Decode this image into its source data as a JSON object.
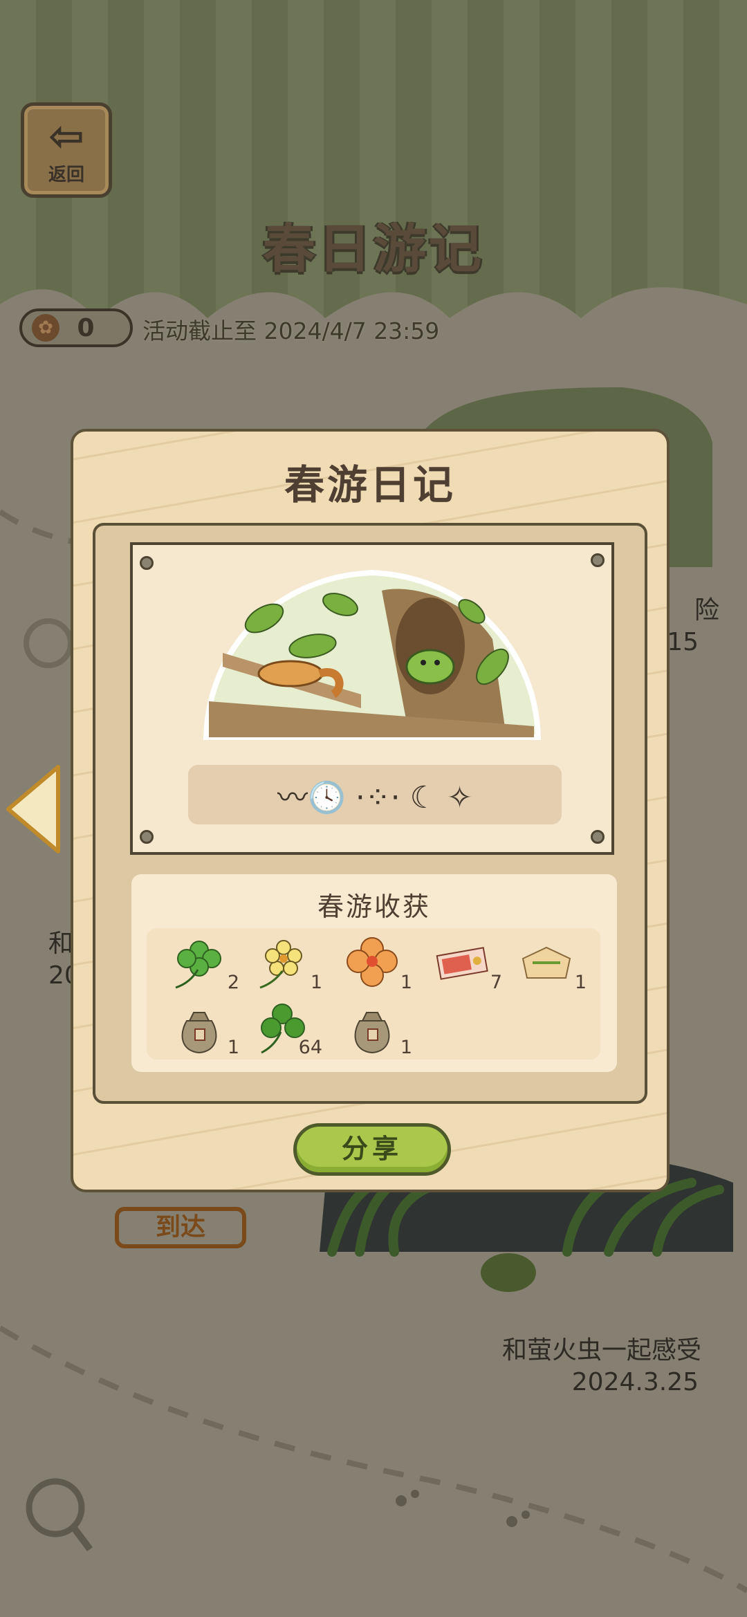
{
  "header": {
    "back_label": "返回",
    "title": "春日游记",
    "clover_count": "0",
    "deadline": "活动截止至 2024/4/7 23:59"
  },
  "background": {
    "right_text_line1": "险",
    "right_text_line2": "15",
    "left_text_line1": "和",
    "left_text_line2": "20",
    "event_title": "和萤火虫一起感受",
    "event_date": "2024.3.25",
    "stamp_label": "到达"
  },
  "modal": {
    "title": "春游日记",
    "diary_icons": "〰🕓 ·⁘· ☾ ✧",
    "harvest_title": "春游收获",
    "items": [
      {
        "icon": "four-leaf-clover-icon",
        "count": "2"
      },
      {
        "icon": "yellow-flower-icon",
        "count": "1"
      },
      {
        "icon": "orange-flower-icon",
        "count": "1"
      },
      {
        "icon": "ticket-icon",
        "count": "7"
      },
      {
        "icon": "bread-icon",
        "count": "1"
      },
      {
        "icon": "seed-bag-icon",
        "count": "1"
      },
      {
        "icon": "three-leaf-clover-icon",
        "count": "64"
      },
      {
        "icon": "seed-bag-icon",
        "count": "1"
      }
    ],
    "share_label": "分享"
  },
  "colors": {
    "modal_bg": "#efdcb4",
    "share_button": "#a9c84c",
    "overlay": "#858071"
  }
}
